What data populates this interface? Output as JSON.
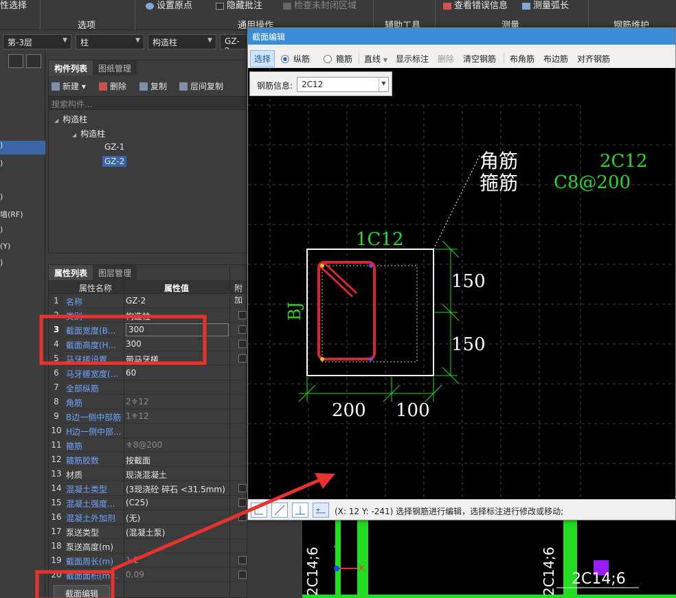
{
  "ribbon": {
    "partial_title": "性选择",
    "groups": [
      "选项",
      "通用操作",
      "辅助工具",
      "测量",
      "钢筋维护"
    ],
    "items": [
      "设置原点",
      "隐藏批注",
      "检查未封闭区域",
      "查看错误信息",
      "测量弧长"
    ]
  },
  "selectors": [
    "第-3层",
    "柱",
    "构造柱",
    "GZ-2"
  ],
  "leftnav": {
    "items": [
      ")",
      ")",
      ")",
      "墙(RF)",
      ")",
      "(Y)",
      ")"
    ]
  },
  "component_panel": {
    "tabs": [
      "构件列表",
      "图纸管理"
    ],
    "toolbar": [
      "新建",
      "删除",
      "复制",
      "层间复制"
    ],
    "search_placeholder": "搜索构件...",
    "tree": {
      "root": "构造柱",
      "child": "构造柱",
      "items": [
        "GZ-1",
        "GZ-2"
      ]
    }
  },
  "property_panel": {
    "tabs": [
      "属性列表",
      "图层管理"
    ],
    "headers": [
      "属性名称",
      "属性值",
      "附加"
    ],
    "rows": [
      {
        "num": "1",
        "name": "名称",
        "value": "GZ-2"
      },
      {
        "num": "2",
        "name": "类别",
        "value": "构造柱"
      },
      {
        "num": "3",
        "name": "截面宽度(B...",
        "value": "300"
      },
      {
        "num": "4",
        "name": "截面高度(H...",
        "value": "300"
      },
      {
        "num": "5",
        "name": "马牙槎设置",
        "value": "带马牙槎"
      },
      {
        "num": "6",
        "name": "马牙槎宽度(...",
        "value": "60"
      },
      {
        "num": "7",
        "name": "全部纵筋",
        "value": ""
      },
      {
        "num": "8",
        "name": "角筋",
        "value": "2⚜12"
      },
      {
        "num": "9",
        "name": "B边一侧中部筋",
        "value": "1⚜12"
      },
      {
        "num": "10",
        "name": "H边一侧中部...",
        "value": ""
      },
      {
        "num": "11",
        "name": "箍筋",
        "value": "⚜8@200"
      },
      {
        "num": "12",
        "name": "箍筋胶数",
        "value": "按截面"
      },
      {
        "num": "13",
        "name": "材质",
        "value": "现浇混凝土"
      },
      {
        "num": "14",
        "name": "混凝土类型",
        "value": "(3现浇砼 碎石 <31.5mm)"
      },
      {
        "num": "15",
        "name": "混凝土强度...",
        "value": "(C25)"
      },
      {
        "num": "16",
        "name": "混凝土外加剂",
        "value": "(无)"
      },
      {
        "num": "17",
        "name": "泵送类型",
        "value": "(混凝土泵)"
      },
      {
        "num": "18",
        "name": "泵送高度(m)",
        "value": ""
      },
      {
        "num": "19",
        "name": "截面周长(m)",
        "value": "1.2"
      },
      {
        "num": "20",
        "name": "截面面积(m...",
        "value": "0.09"
      }
    ],
    "edit_button": "截面编辑"
  },
  "dialog": {
    "title": "截面编辑",
    "toolbar": [
      "选择",
      "纵筋",
      "箍筋",
      "直线",
      "显示标注",
      "删除",
      "清空钢筋",
      "布角筋",
      "布边筋",
      "对齐钢筋"
    ],
    "rebar_info_label": "钢筋信息:",
    "rebar_info_value": "2C12",
    "canvas": {
      "label_corner": "角筋",
      "label_stirrup": "箍筋",
      "label_corner_val": "2C12",
      "label_stirrup_val": "C8@200",
      "top_label": "1C12",
      "side_label": "BJ",
      "dim_right_1": "150",
      "dim_right_2": "150",
      "dim_bottom_1": "200",
      "dim_bottom_2": "100"
    },
    "status": "(X: 12 Y: -241)  选择钢筋进行编辑，选择标注进行修改或移动;"
  },
  "background_drawing": {
    "labels": [
      "2C14;6",
      "2C14;6",
      "2C14;6"
    ]
  },
  "colors": {
    "highlight_red": "#e8322e",
    "rebar_green": "#22dd22",
    "accent_blue": "#3b8cd6"
  }
}
